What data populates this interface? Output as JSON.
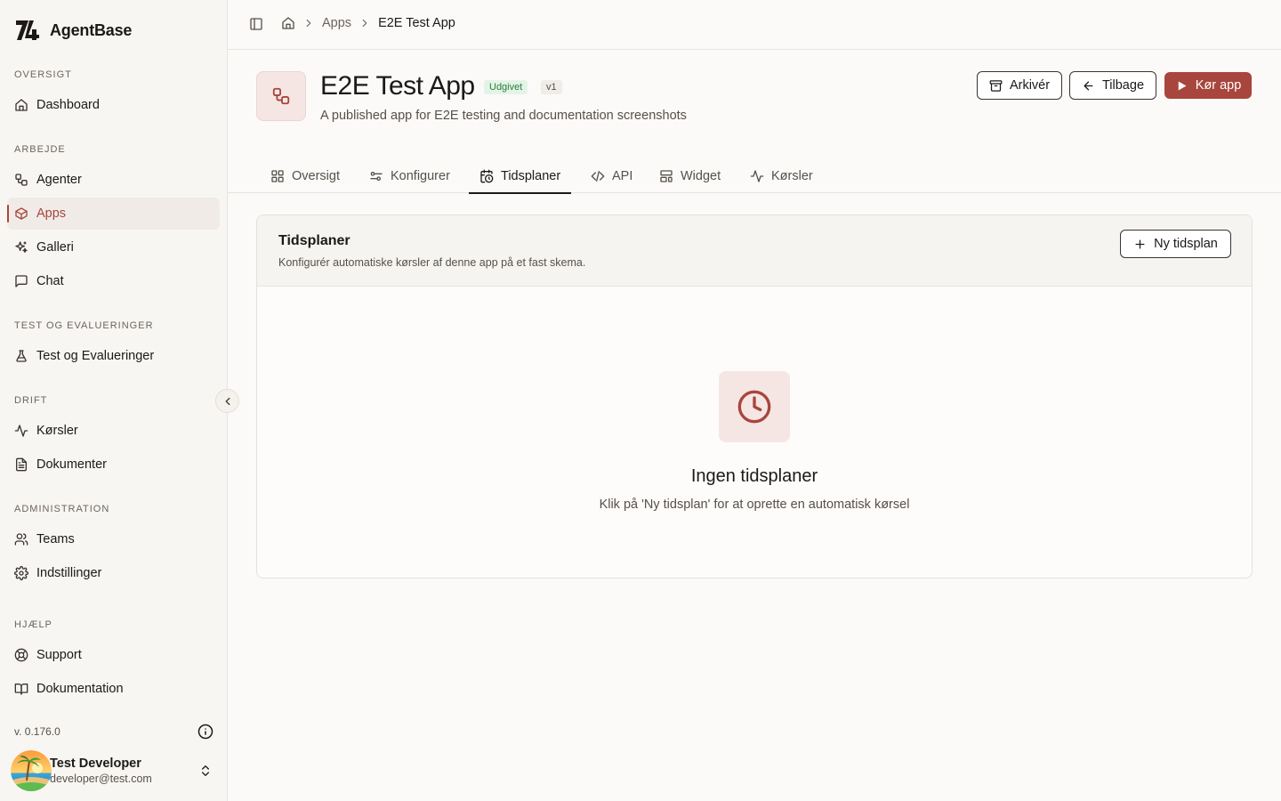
{
  "brand": {
    "name": "AgentBase"
  },
  "sidebar": {
    "sections": [
      {
        "label": "OVERSIGT"
      },
      {
        "label": "ARBEJDE"
      },
      {
        "label": "TEST OG EVALUERINGER"
      },
      {
        "label": "DRIFT"
      },
      {
        "label": "ADMINISTRATION"
      },
      {
        "label": "HJÆLP"
      }
    ],
    "items": [
      {
        "label": "Dashboard",
        "icon": "home-icon"
      },
      {
        "label": "Agenter",
        "icon": "workflow-icon"
      },
      {
        "label": "Apps",
        "icon": "package-icon",
        "active": true
      },
      {
        "label": "Galleri",
        "icon": "sparkles-icon"
      },
      {
        "label": "Chat",
        "icon": "message-square-icon"
      },
      {
        "label": "Test og Evalueringer",
        "icon": "flask-icon"
      },
      {
        "label": "Kørsler",
        "icon": "activity-icon"
      },
      {
        "label": "Dokumenter",
        "icon": "file-text-icon"
      },
      {
        "label": "Teams",
        "icon": "users-icon"
      },
      {
        "label": "Indstillinger",
        "icon": "settings-icon"
      },
      {
        "label": "Support",
        "icon": "life-buoy-icon"
      },
      {
        "label": "Dokumentation",
        "icon": "book-open-icon"
      }
    ],
    "version": "v. 0.176.0",
    "user": {
      "name": "Test Developer",
      "email": "developer@test.com"
    }
  },
  "breadcrumb": {
    "section": "Apps",
    "current": "E2E Test App"
  },
  "app": {
    "title": "E2E Test App",
    "status_badge": "Udgivet",
    "version_badge": "v1",
    "description": "A published app for E2E testing and documentation screenshots"
  },
  "actions": {
    "archive": "Arkivér",
    "back": "Tilbage",
    "run": "Kør app"
  },
  "tabs": [
    {
      "label": "Oversigt",
      "icon": "layout-grid-icon"
    },
    {
      "label": "Konfigurer",
      "icon": "sliders-icon"
    },
    {
      "label": "Tidsplaner",
      "icon": "calendar-clock-icon",
      "active": true
    },
    {
      "label": "API",
      "icon": "code-icon"
    },
    {
      "label": "Widget",
      "icon": "layout-template-icon"
    },
    {
      "label": "Kørsler",
      "icon": "activity-icon"
    }
  ],
  "schedules": {
    "title": "Tidsplaner",
    "subtitle": "Konfigurér automatiske kørsler af denne app på et fast skema.",
    "new_button": "Ny tidsplan",
    "empty_title": "Ingen tidsplaner",
    "empty_text": "Klik på 'Ny tidsplan' for at oprette en automatisk kørsel"
  },
  "colors": {
    "accent": "#a8453d",
    "published_bg": "#e3f4e6",
    "published_fg": "#2f7a3e"
  }
}
